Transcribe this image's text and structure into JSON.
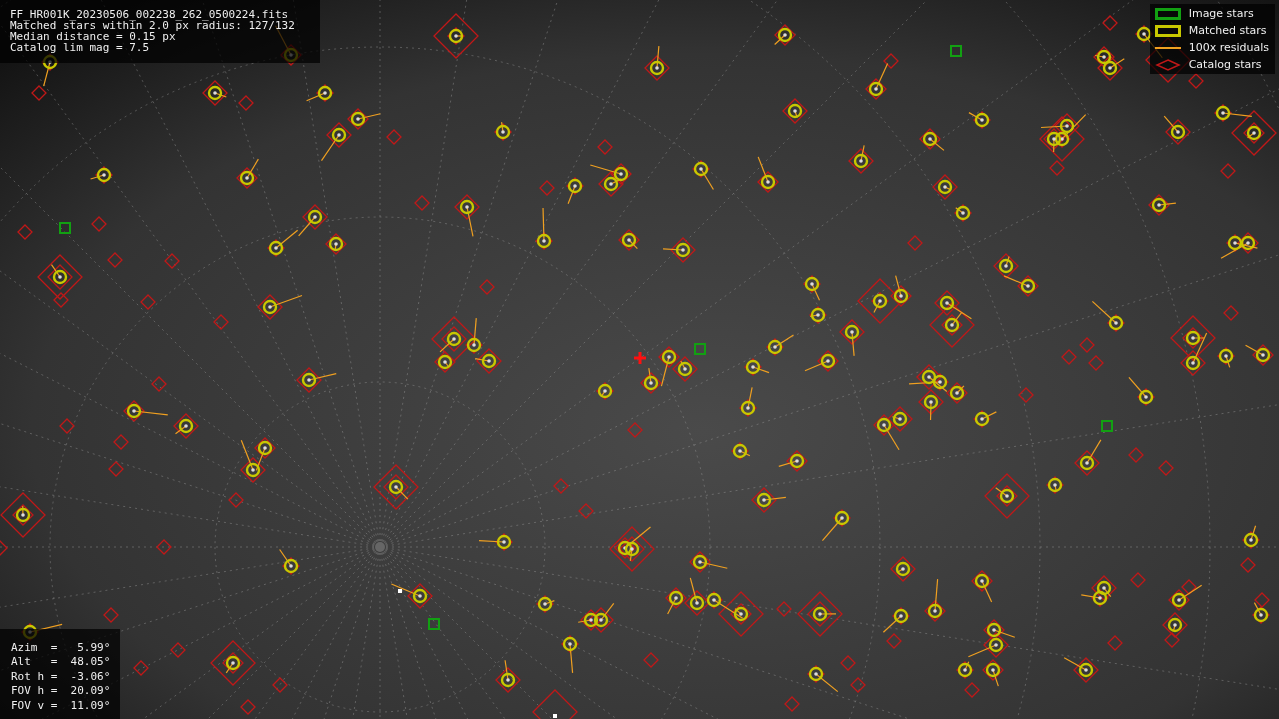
{
  "header": {
    "lines": [
      "FF_HR001K_20230506_002238_262_0500224.fits",
      "Matched stars within 2.0 px radius: 127/132",
      "Median distance = 0.15 px",
      "Catalog lim mag = 7.5"
    ]
  },
  "legend": {
    "items": [
      {
        "kind": "image",
        "label": "Image stars"
      },
      {
        "kind": "matched",
        "label": "Matched stars"
      },
      {
        "kind": "residual",
        "label": "100x residuals"
      },
      {
        "kind": "catalog",
        "label": "Catalog stars"
      }
    ]
  },
  "pointing": {
    "rows": [
      "Azim  =   5.99°",
      "Alt   =  48.05°",
      "Rot h =  -3.06°",
      "FOV h =  20.09°",
      "FOV v =  11.09°"
    ]
  }
}
